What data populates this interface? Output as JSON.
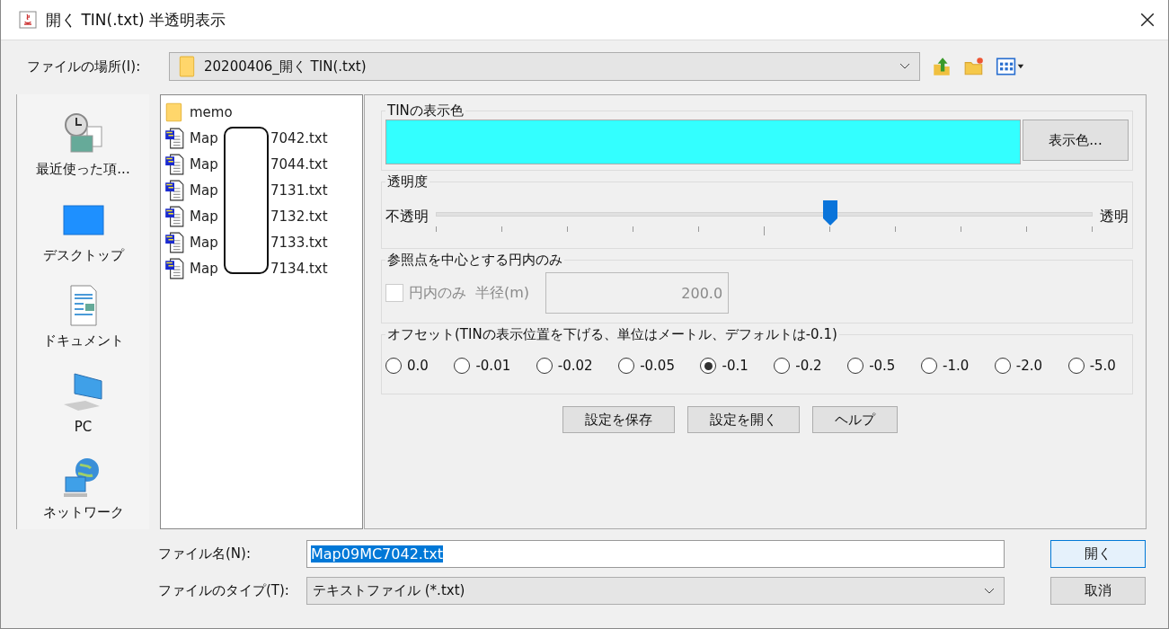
{
  "window": {
    "title": "開く TIN(.txt) 半透明表示"
  },
  "location": {
    "label": "ファイルの場所(I):",
    "value": "20200406_開く TIN(.txt)"
  },
  "places": [
    {
      "kind": "recent",
      "label": "最近使った項..."
    },
    {
      "kind": "desktop",
      "label": "デスクトップ"
    },
    {
      "kind": "documents",
      "label": "ドキュメント"
    },
    {
      "kind": "pc",
      "label": "PC"
    },
    {
      "kind": "network",
      "label": "ネットワーク"
    }
  ],
  "files": [
    {
      "kind": "folder",
      "name_start": "memo"
    },
    {
      "kind": "file",
      "name_start": "Map",
      "name_end": "7042.txt"
    },
    {
      "kind": "file",
      "name_start": "Map",
      "name_end": "7044.txt"
    },
    {
      "kind": "file",
      "name_start": "Map",
      "name_end": "7131.txt"
    },
    {
      "kind": "file",
      "name_start": "Map",
      "name_end": "7132.txt"
    },
    {
      "kind": "file",
      "name_start": "Map",
      "name_end": "7133.txt"
    },
    {
      "kind": "file",
      "name_start": "Map",
      "name_end": "7134.txt"
    }
  ],
  "display_color": {
    "title": "TINの表示色",
    "color": "#33ffff",
    "button": "表示色..."
  },
  "transparency": {
    "title": "透明度",
    "min_label": "不透明",
    "max_label": "透明",
    "level": 0.6
  },
  "circle": {
    "title": "参照点を中心とする円内のみ",
    "checkbox_label": "円内のみ",
    "checked": false,
    "disabled": true,
    "radius_label": "半径(m)",
    "radius_value": "200.0"
  },
  "offset": {
    "title": "オフセット(TINの表示位置を下げる、単位はメートル、デフォルトは-0.1)",
    "options": [
      {
        "label": "0.0",
        "selected": false
      },
      {
        "label": "-0.01",
        "selected": false
      },
      {
        "label": "-0.02",
        "selected": false
      },
      {
        "label": "-0.05",
        "selected": false
      },
      {
        "label": "-0.1",
        "selected": true
      },
      {
        "label": "-0.2",
        "selected": false
      },
      {
        "label": "-0.5",
        "selected": false
      },
      {
        "label": "-1.0",
        "selected": false
      },
      {
        "label": "-2.0",
        "selected": false
      },
      {
        "label": "-5.0",
        "selected": false
      }
    ]
  },
  "settings_buttons": [
    "設定を保存",
    "設定を開く",
    "ヘルプ"
  ],
  "file_name": {
    "label": "ファイル名(N):",
    "value": "Map09MC7042.txt"
  },
  "file_type": {
    "label": "ファイルのタイプ(T):",
    "value": "テキストファイル (*.txt)"
  },
  "buttons": [
    "開く",
    "取消"
  ]
}
